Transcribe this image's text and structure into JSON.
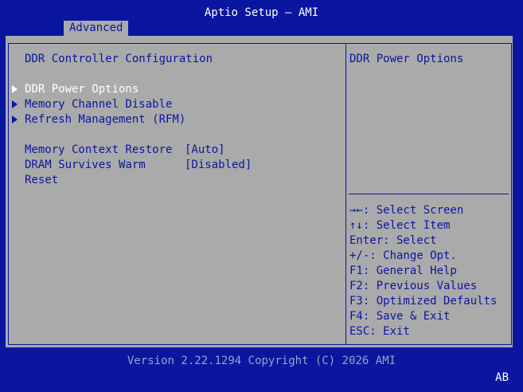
{
  "header": {
    "title": "Aptio Setup – AMI",
    "tab": "Advanced"
  },
  "main": {
    "section_title": "DDR Controller Configuration",
    "submenus": [
      {
        "label": "DDR Power Options",
        "selected": true
      },
      {
        "label": "Memory Channel Disable",
        "selected": false
      },
      {
        "label": "Refresh Management (RFM)",
        "selected": false
      }
    ],
    "settings": [
      {
        "label": "Memory Context Restore",
        "value": "[Auto]"
      },
      {
        "label": "DRAM Survives Warm",
        "value": "[Disabled]"
      }
    ],
    "reset_label": "Reset"
  },
  "help": {
    "description": "DDR Power Options",
    "keys": [
      "→←: Select Screen",
      "↑↓: Select Item",
      "Enter: Select",
      "+/-: Change Opt.",
      "F1: General Help",
      "F2: Previous Values",
      "F3: Optimized Defaults",
      "F4: Save & Exit",
      "ESC: Exit"
    ]
  },
  "footer": {
    "version": "Version 2.22.1294 Copyright (C) 2026 AMI",
    "corner": "AB"
  },
  "colors": {
    "background_blue": "#0a16a0",
    "panel_gray": "#aaaaaa",
    "selected_text": "#ffffff"
  }
}
